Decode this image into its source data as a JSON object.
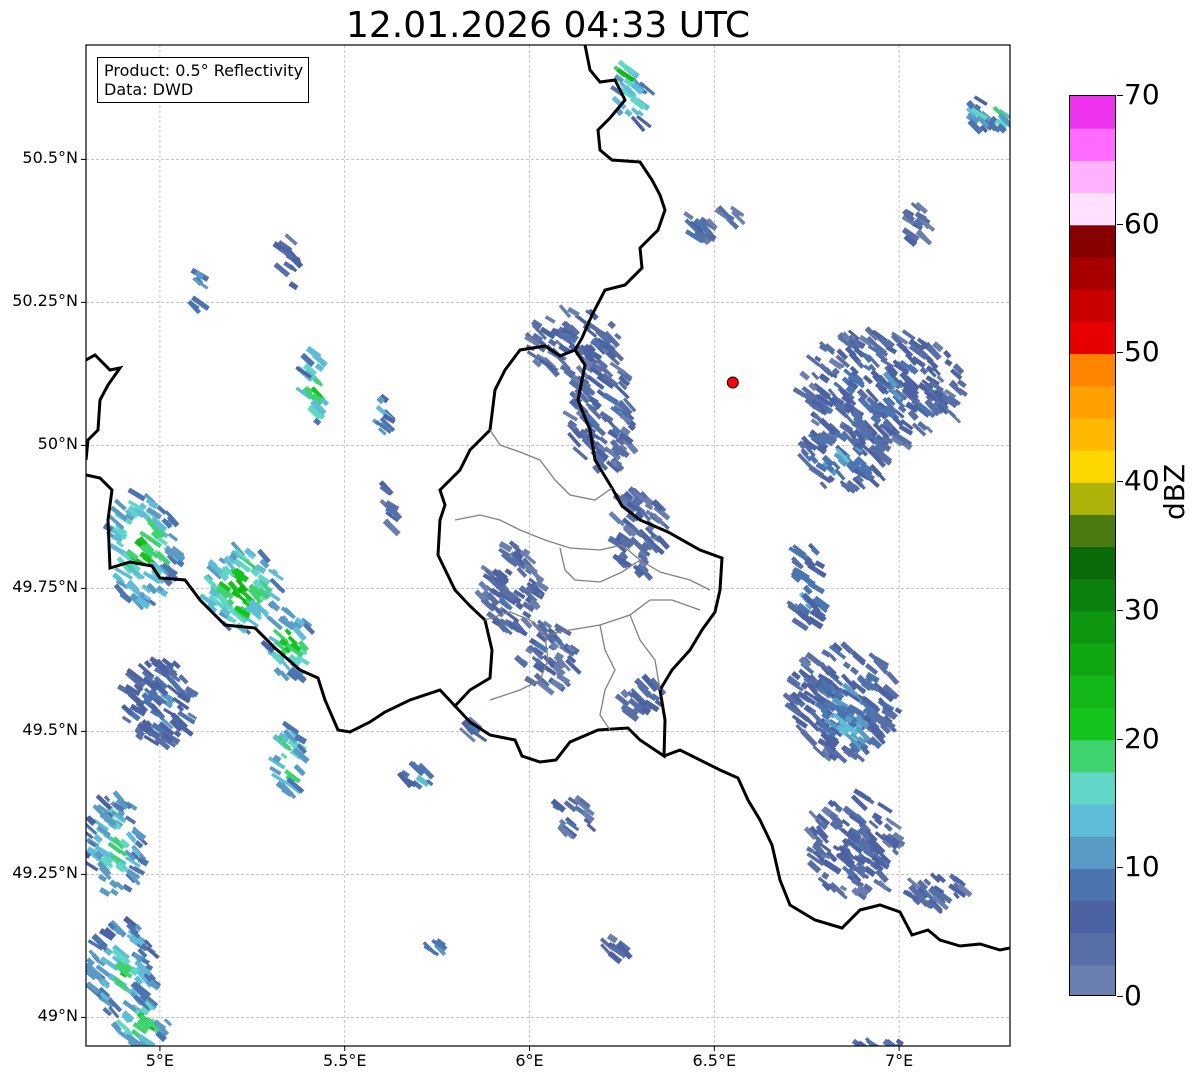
{
  "title": "12.01.2026 04:33 UTC",
  "info": {
    "product": "Product: 0.5° Reflectivity",
    "data_source": "Data: DWD"
  },
  "axes": {
    "lat_ticks": [
      "50.5°N",
      "50.25°N",
      "50°N",
      "49.75°N",
      "49.5°N",
      "49.25°N",
      "49°N"
    ],
    "lat_values": [
      50.5,
      50.25,
      50.0,
      49.75,
      49.5,
      49.25,
      49.0
    ],
    "lon_ticks": [
      "5°E",
      "5.5°E",
      "6°E",
      "6.5°E",
      "7°E"
    ],
    "lon_values": [
      5.0,
      5.5,
      6.0,
      6.5,
      7.0
    ],
    "lat_range": [
      48.95,
      50.7
    ],
    "lon_range": [
      4.8,
      7.3
    ]
  },
  "colorbar": {
    "label": "dBZ",
    "tick_labels": [
      "0",
      "10",
      "20",
      "30",
      "40",
      "50",
      "60",
      "70"
    ],
    "tick_values": [
      0,
      10,
      20,
      30,
      40,
      50,
      60,
      70
    ],
    "range": [
      0,
      70
    ],
    "colors": [
      "#6a7fad",
      "#586ea6",
      "#4d62a3",
      "#4b74b0",
      "#5a9bc6",
      "#5fbcd8",
      "#5fd6c6",
      "#3ed36f",
      "#13c41c",
      "#11b817",
      "#10a712",
      "#0d960f",
      "#0b800c",
      "#096a0a",
      "#4b7a10",
      "#aeb30a",
      "#ffd700",
      "#ffb800",
      "#ffa000",
      "#ff8400",
      "#e60000",
      "#c80000",
      "#a80000",
      "#870000",
      "#ffe0ff",
      "#ffb3ff",
      "#ff6aff",
      "#ee33ee"
    ]
  },
  "radar_site": {
    "lat": 50.11,
    "lon": 6.55,
    "color": "#ff0000"
  },
  "colors": {
    "border_major": "#000000",
    "border_minor": "#808080",
    "grid": "#b0b0b0"
  },
  "echoes": [
    {
      "lat": 50.6,
      "lon": 6.28,
      "dbz": 18,
      "w": 0.1,
      "h": 0.09
    },
    {
      "lat": 50.65,
      "lon": 6.26,
      "dbz": 22,
      "w": 0.06,
      "h": 0.04
    },
    {
      "lat": 50.58,
      "lon": 7.22,
      "dbz": 14,
      "w": 0.09,
      "h": 0.06
    },
    {
      "lat": 50.57,
      "lon": 7.27,
      "dbz": 22,
      "w": 0.04,
      "h": 0.04
    },
    {
      "lat": 50.32,
      "lon": 5.35,
      "dbz": 6,
      "w": 0.05,
      "h": 0.1
    },
    {
      "lat": 50.28,
      "lon": 5.1,
      "dbz": 14,
      "w": 0.03,
      "h": 0.1
    },
    {
      "lat": 50.1,
      "lon": 5.42,
      "dbz": 22,
      "w": 0.07,
      "h": 0.13
    },
    {
      "lat": 50.05,
      "lon": 5.6,
      "dbz": 16,
      "w": 0.04,
      "h": 0.08
    },
    {
      "lat": 49.9,
      "lon": 5.62,
      "dbz": 8,
      "w": 0.03,
      "h": 0.1
    },
    {
      "lat": 50.18,
      "lon": 6.12,
      "dbz": 6,
      "w": 0.25,
      "h": 0.12
    },
    {
      "lat": 50.05,
      "lon": 6.2,
      "dbz": 7,
      "w": 0.18,
      "h": 0.2
    },
    {
      "lat": 49.85,
      "lon": 6.3,
      "dbz": 6,
      "w": 0.15,
      "h": 0.15
    },
    {
      "lat": 49.75,
      "lon": 5.95,
      "dbz": 6,
      "w": 0.18,
      "h": 0.15
    },
    {
      "lat": 49.63,
      "lon": 6.05,
      "dbz": 6,
      "w": 0.15,
      "h": 0.12
    },
    {
      "lat": 49.56,
      "lon": 6.3,
      "dbz": 7,
      "w": 0.12,
      "h": 0.08
    },
    {
      "lat": 50.38,
      "lon": 6.45,
      "dbz": 8,
      "w": 0.1,
      "h": 0.06
    },
    {
      "lat": 50.1,
      "lon": 6.95,
      "dbz": 8,
      "w": 0.45,
      "h": 0.2
    },
    {
      "lat": 49.98,
      "lon": 6.85,
      "dbz": 10,
      "w": 0.25,
      "h": 0.12
    },
    {
      "lat": 49.75,
      "lon": 6.75,
      "dbz": 12,
      "w": 0.1,
      "h": 0.15
    },
    {
      "lat": 49.55,
      "lon": 6.85,
      "dbz": 10,
      "w": 0.3,
      "h": 0.2
    },
    {
      "lat": 49.5,
      "lon": 6.87,
      "dbz": 15,
      "w": 0.15,
      "h": 0.08
    },
    {
      "lat": 49.3,
      "lon": 6.88,
      "dbz": 7,
      "w": 0.25,
      "h": 0.18
    },
    {
      "lat": 49.22,
      "lon": 7.1,
      "dbz": 7,
      "w": 0.2,
      "h": 0.06
    },
    {
      "lat": 49.35,
      "lon": 6.12,
      "dbz": 7,
      "w": 0.12,
      "h": 0.06
    },
    {
      "lat": 49.12,
      "lon": 6.22,
      "dbz": 8,
      "w": 0.08,
      "h": 0.04
    },
    {
      "lat": 49.12,
      "lon": 5.75,
      "dbz": 12,
      "w": 0.06,
      "h": 0.02
    },
    {
      "lat": 49.82,
      "lon": 4.95,
      "dbz": 22,
      "w": 0.2,
      "h": 0.2
    },
    {
      "lat": 49.75,
      "lon": 5.22,
      "dbz": 24,
      "w": 0.2,
      "h": 0.15
    },
    {
      "lat": 49.65,
      "lon": 5.35,
      "dbz": 22,
      "w": 0.12,
      "h": 0.12
    },
    {
      "lat": 49.55,
      "lon": 5.0,
      "dbz": 10,
      "w": 0.2,
      "h": 0.15
    },
    {
      "lat": 49.45,
      "lon": 5.35,
      "dbz": 22,
      "w": 0.08,
      "h": 0.12
    },
    {
      "lat": 49.3,
      "lon": 4.88,
      "dbz": 18,
      "w": 0.16,
      "h": 0.18
    },
    {
      "lat": 49.08,
      "lon": 4.9,
      "dbz": 18,
      "w": 0.18,
      "h": 0.18
    },
    {
      "lat": 48.99,
      "lon": 4.95,
      "dbz": 22,
      "w": 0.15,
      "h": 0.08
    },
    {
      "lat": 49.42,
      "lon": 5.7,
      "dbz": 14,
      "w": 0.08,
      "h": 0.04
    },
    {
      "lat": 49.5,
      "lon": 5.85,
      "dbz": 8,
      "w": 0.04,
      "h": 0.03
    },
    {
      "lat": 48.95,
      "lon": 6.95,
      "dbz": 10,
      "w": 0.15,
      "h": 0.03
    },
    {
      "lat": 50.4,
      "lon": 6.55,
      "dbz": 6,
      "w": 0.06,
      "h": 0.03
    },
    {
      "lat": 50.38,
      "lon": 7.05,
      "dbz": 6,
      "w": 0.06,
      "h": 0.08
    }
  ]
}
